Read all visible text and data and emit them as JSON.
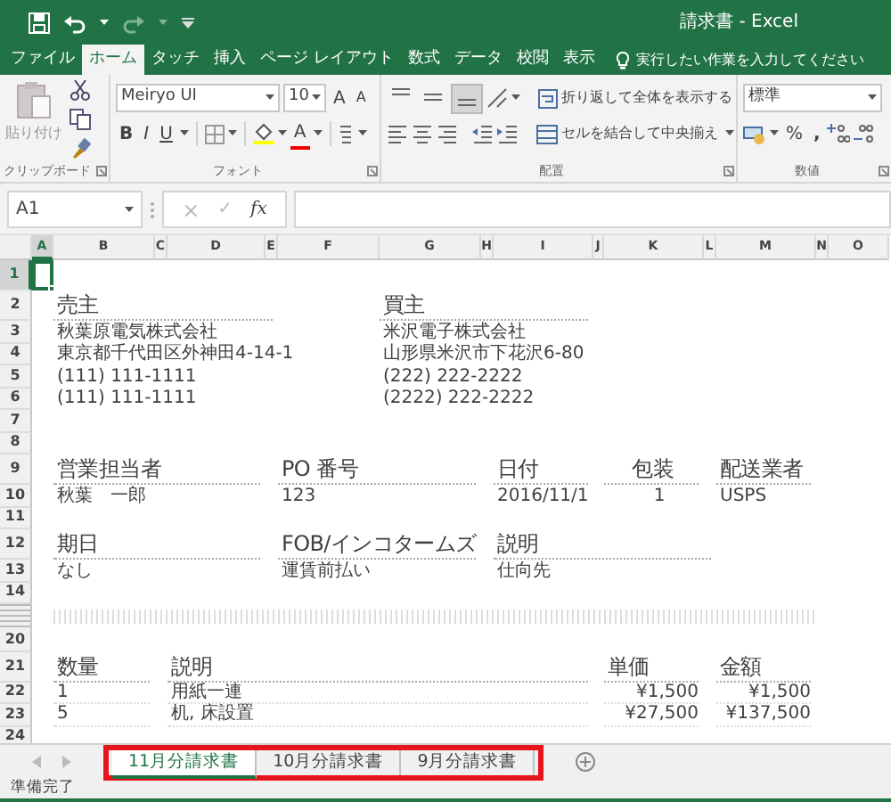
{
  "window": {
    "title": "請求書 - Excel"
  },
  "tabs": [
    {
      "label": "ファイル",
      "selected": false
    },
    {
      "label": "ホーム",
      "selected": true
    },
    {
      "label": "タッチ",
      "selected": false
    },
    {
      "label": "挿入",
      "selected": false
    },
    {
      "label": "ページ レイアウト",
      "selected": false
    },
    {
      "label": "数式",
      "selected": false
    },
    {
      "label": "データ",
      "selected": false
    },
    {
      "label": "校閲",
      "selected": false
    },
    {
      "label": "表示",
      "selected": false
    }
  ],
  "tell_me": "実行したい作業を入力してください",
  "ribbon": {
    "clipboard": {
      "label": "クリップボード",
      "paste": "貼り付け"
    },
    "font": {
      "label": "フォント",
      "font_name": "Meiryo UI",
      "font_size": "10",
      "grow": "A",
      "shrink": "A",
      "bold": "B",
      "italic": "I",
      "underline": "U",
      "font_color": "A"
    },
    "alignment": {
      "label": "配置",
      "vertical_align": [
        {
          "selected": false
        },
        {
          "selected": false
        },
        {
          "selected": true
        }
      ],
      "wrap_text": "折り返して全体を表示する",
      "merge_center": "セルを結合して中央揃え"
    },
    "number": {
      "label": "数値",
      "format": "標準",
      "percent": "%",
      "comma": ","
    }
  },
  "formula_bar": {
    "name_box": "A1",
    "cancel": "×",
    "enter": "✓",
    "function": "fx"
  },
  "columns": [
    {
      "letter": "A",
      "selected": true
    },
    {
      "letter": "B",
      "selected": false
    },
    {
      "letter": "C",
      "selected": false
    },
    {
      "letter": "D",
      "selected": false
    },
    {
      "letter": "E",
      "selected": false
    },
    {
      "letter": "F",
      "selected": false
    },
    {
      "letter": "G",
      "selected": false
    },
    {
      "letter": "H",
      "selected": false
    },
    {
      "letter": "I",
      "selected": false
    },
    {
      "letter": "J",
      "selected": false
    },
    {
      "letter": "K",
      "selected": false
    },
    {
      "letter": "L",
      "selected": false
    },
    {
      "letter": "M",
      "selected": false
    },
    {
      "letter": "N",
      "selected": false
    },
    {
      "letter": "O",
      "selected": false
    }
  ],
  "rows": [
    {
      "kind": "row",
      "number": "1",
      "selected": true,
      "cells": {}
    },
    {
      "kind": "row",
      "number": "2",
      "selected": false,
      "cells": {
        "B": {
          "kind": "heading",
          "text": "売主"
        },
        "G": {
          "kind": "heading",
          "text": "買主"
        }
      }
    },
    {
      "kind": "row",
      "number": "3",
      "selected": false,
      "cells": {
        "B": {
          "kind": "value",
          "text": "秋葉原電気株式会社"
        },
        "G": {
          "kind": "value",
          "text": "米沢電子株式会社"
        }
      }
    },
    {
      "kind": "row",
      "number": "4",
      "selected": false,
      "cells": {
        "B": {
          "kind": "value",
          "text": "東京都千代田区外神田4-14-1"
        },
        "G": {
          "kind": "value",
          "text": "山形県米沢市下花沢6-80"
        }
      }
    },
    {
      "kind": "row",
      "number": "5",
      "selected": false,
      "cells": {
        "B": {
          "kind": "value",
          "text": "(111) 111-1111"
        },
        "G": {
          "kind": "value",
          "text": "(222) 222-2222"
        }
      }
    },
    {
      "kind": "row",
      "number": "6",
      "selected": false,
      "cells": {
        "B": {
          "kind": "value",
          "text": "(111) 111-1111"
        },
        "G": {
          "kind": "value",
          "text": "(2222) 222-2222"
        }
      }
    },
    {
      "kind": "row",
      "number": "7",
      "selected": false,
      "cells": {}
    },
    {
      "kind": "row",
      "number": "8",
      "selected": false,
      "cells": {}
    },
    {
      "kind": "row",
      "number": "9",
      "selected": false,
      "cells": {
        "B": {
          "kind": "heading",
          "text": "営業担当者"
        },
        "F": {
          "kind": "heading",
          "text": "PO 番号"
        },
        "I": {
          "kind": "heading",
          "text": "日付"
        },
        "K": {
          "kind": "heading-center",
          "text": "包装"
        },
        "M": {
          "kind": "heading",
          "text": "配送業者"
        }
      }
    },
    {
      "kind": "row",
      "number": "10",
      "selected": false,
      "cells": {
        "B": {
          "kind": "value",
          "text": "秋葉　一郎"
        },
        "F": {
          "kind": "value",
          "text": "123"
        },
        "I": {
          "kind": "value",
          "text": "2016/11/1"
        },
        "K": {
          "kind": "count",
          "text": "1"
        },
        "M": {
          "kind": "value",
          "text": "USPS"
        }
      }
    },
    {
      "kind": "row",
      "number": "11",
      "selected": false,
      "cells": {}
    },
    {
      "kind": "row",
      "number": "12",
      "selected": false,
      "cells": {
        "B": {
          "kind": "heading",
          "text": "期日"
        },
        "F": {
          "kind": "heading",
          "text": "FOB/インコタームズ"
        },
        "I": {
          "kind": "heading",
          "text": "説明"
        }
      }
    },
    {
      "kind": "row",
      "number": "13",
      "selected": false,
      "cells": {
        "B": {
          "kind": "value",
          "text": "なし"
        },
        "F": {
          "kind": "value",
          "text": "運賃前払い"
        },
        "I": {
          "kind": "value",
          "text": "仕向先"
        }
      }
    },
    {
      "kind": "row",
      "number": "14",
      "selected": false,
      "cells": {}
    },
    {
      "kind": "collapsed"
    },
    {
      "kind": "row",
      "number": "20",
      "selected": false,
      "cells": {}
    },
    {
      "kind": "row",
      "number": "21",
      "selected": false,
      "cells": {
        "B": {
          "kind": "heading",
          "text": "数量"
        },
        "D": {
          "kind": "heading",
          "text": "説明"
        },
        "K": {
          "kind": "heading",
          "text": "単価"
        },
        "M": {
          "kind": "heading",
          "text": "金額"
        }
      }
    },
    {
      "kind": "row",
      "number": "22",
      "selected": false,
      "cells": {
        "B": {
          "kind": "line",
          "text": "1"
        },
        "D": {
          "kind": "line",
          "text": "用紙一連"
        },
        "K": {
          "kind": "amount",
          "text": "¥1,500"
        },
        "M": {
          "kind": "amount",
          "text": "¥1,500"
        }
      }
    },
    {
      "kind": "row",
      "number": "23",
      "selected": false,
      "cells": {
        "B": {
          "kind": "line",
          "text": "5"
        },
        "D": {
          "kind": "line",
          "text": "机, 床設置"
        },
        "K": {
          "kind": "amount",
          "text": "¥27,500"
        },
        "M": {
          "kind": "amount",
          "text": "¥137,500"
        }
      }
    },
    {
      "kind": "row",
      "number": "24",
      "selected": false,
      "cells": {}
    }
  ],
  "sheet_tabs": {
    "highlighted": true,
    "tabs": [
      {
        "label": "11月分請求書",
        "selected": true
      },
      {
        "label": "10月分請求書",
        "selected": false
      },
      {
        "label": "9月分請求書",
        "selected": false
      }
    ]
  },
  "status_bar": {
    "text": "準備完了"
  }
}
